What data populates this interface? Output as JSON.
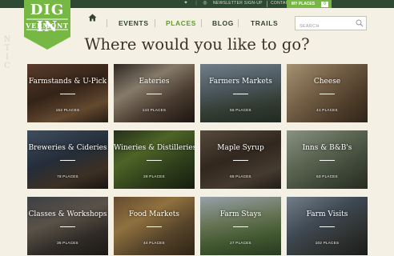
{
  "topbar": {
    "social_icons": [
      "twitter-icon",
      "facebook-icon",
      "instagram-icon"
    ],
    "newsletter": "NEWSLETTER SIGN-UP",
    "contact": "CONTACT US",
    "my_places": "MY PLACES",
    "my_places_count": "0"
  },
  "logo": {
    "line1": "DIG IN",
    "line2": "VERMONT"
  },
  "nav": {
    "home_icon": "home-icon",
    "items": [
      {
        "label": "EVENTS",
        "active": false
      },
      {
        "label": "PLACES",
        "active": true
      },
      {
        "label": "BLOG",
        "active": false
      },
      {
        "label": "TRAILS",
        "active": false
      }
    ],
    "search_placeholder": "SEARCH",
    "search_icon": "search-icon"
  },
  "side_text": "NTIC",
  "heading": "Where would you like to go?",
  "categories": [
    {
      "title": "Farmstands & U-Pick",
      "count": "152 PLACES"
    },
    {
      "title": "Eateries",
      "count": "143 PLACES"
    },
    {
      "title": "Farmers Markets",
      "count": "56 PLACES"
    },
    {
      "title": "Cheese",
      "count": "41 PLACES"
    },
    {
      "title": "Breweries & Cideries",
      "count": "78 PLACES"
    },
    {
      "title": "Wineries & Distilleries",
      "count": "28 PLACES"
    },
    {
      "title": "Maple Syrup",
      "count": "65 PLACES"
    },
    {
      "title": "Inns & B&B's",
      "count": "63 PLACES"
    },
    {
      "title": "Classes & Workshops",
      "count": "35 PLACES"
    },
    {
      "title": "Food Markets",
      "count": "44 PLACES"
    },
    {
      "title": "Farm Stays",
      "count": "27 PLACES"
    },
    {
      "title": "Farm Visits",
      "count": "102 PLACES"
    }
  ],
  "colors": {
    "brand_green": "#76b843",
    "nav_active": "#5e9a2e",
    "topbar_bg": "#2f4a32",
    "page_bg": "#f4f1e4"
  }
}
